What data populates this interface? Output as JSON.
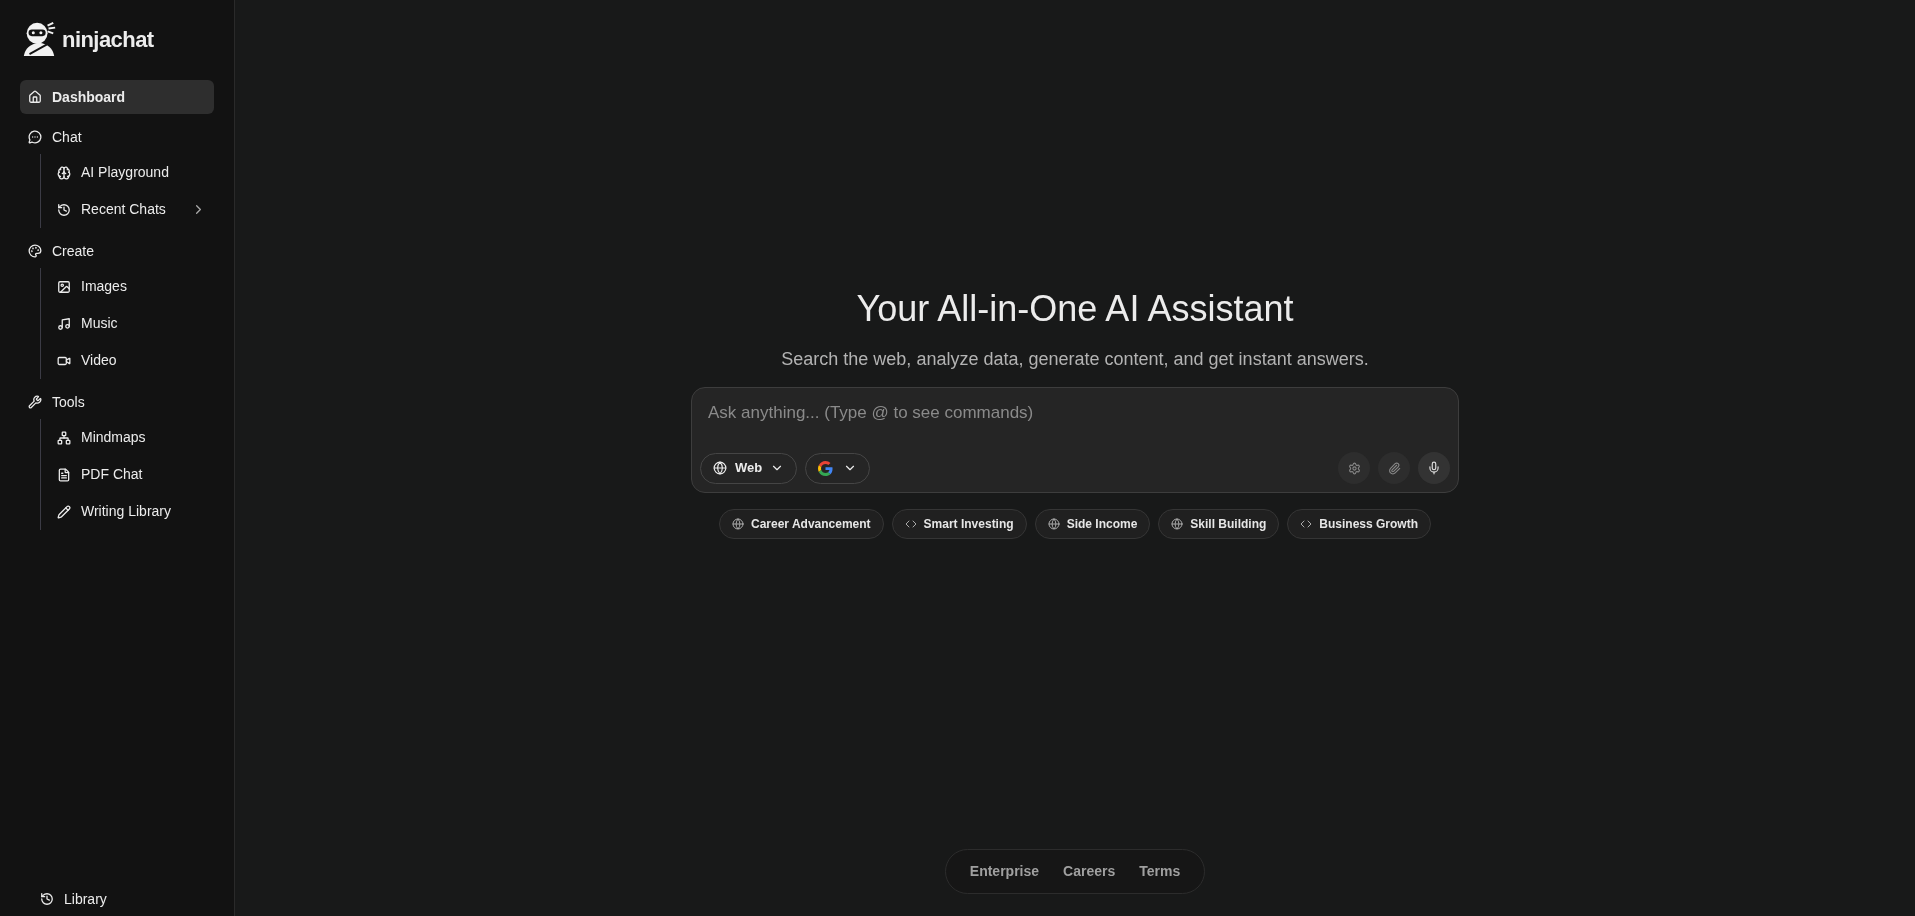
{
  "brand": {
    "name": "ninjachat"
  },
  "sidebar": {
    "items": [
      {
        "label": "Dashboard",
        "selected": true
      },
      {
        "label": "Chat",
        "selected": false,
        "children": [
          {
            "label": "AI Playground",
            "selected": false
          },
          {
            "label": "Recent Chats",
            "selected": false,
            "expanded": false
          }
        ]
      },
      {
        "label": "Create",
        "selected": false,
        "children": [
          {
            "label": "Images",
            "selected": false
          },
          {
            "label": "Music",
            "selected": false
          },
          {
            "label": "Video",
            "selected": false
          }
        ]
      },
      {
        "label": "Tools",
        "selected": false,
        "children": [
          {
            "label": "Mindmaps",
            "selected": false
          },
          {
            "label": "PDF Chat",
            "selected": false
          },
          {
            "label": "Writing Library",
            "selected": false
          }
        ]
      }
    ],
    "footer_item": {
      "label": "Library"
    }
  },
  "hero": {
    "title": "Your All-in-One AI Assistant",
    "subtitle": "Search the web, analyze data, generate content, and get instant answers."
  },
  "composer": {
    "placeholder": "Ask anything... (Type @ to see commands)",
    "mode": {
      "label": "Web"
    }
  },
  "suggestions": [
    {
      "label": "Career Advancement",
      "kind": "web"
    },
    {
      "label": "Smart Investing",
      "kind": "code"
    },
    {
      "label": "Side Income",
      "kind": "web"
    },
    {
      "label": "Skill Building",
      "kind": "web"
    },
    {
      "label": "Business Growth",
      "kind": "code"
    }
  ],
  "footer_links": [
    "Enterprise",
    "Careers",
    "Terms"
  ]
}
